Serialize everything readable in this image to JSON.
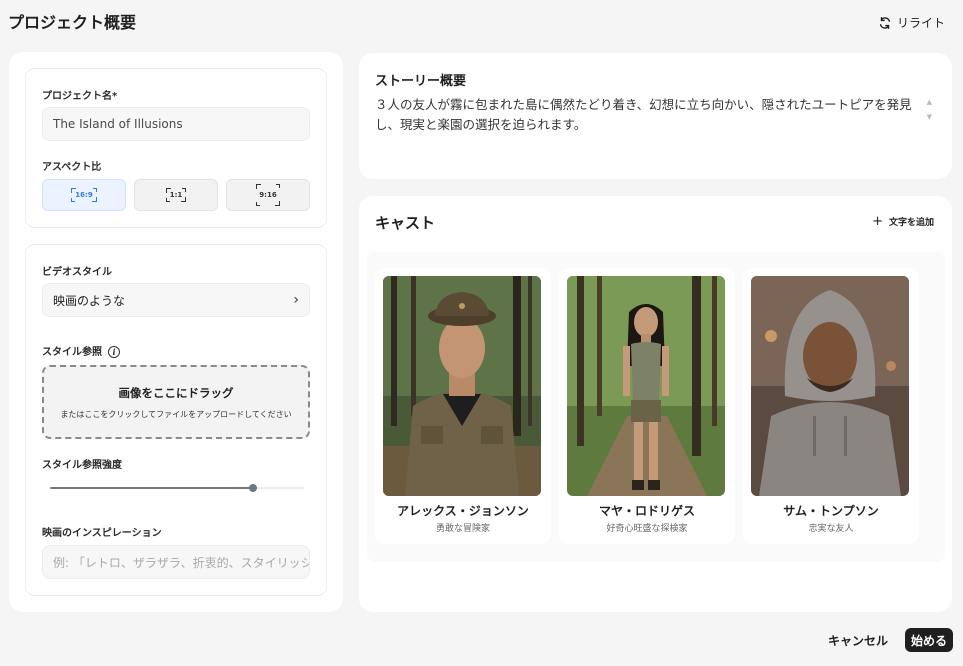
{
  "header": {
    "title": "プロジェクト概要",
    "rewrite_label": "リライト"
  },
  "project": {
    "name_label": "プロジェクト名*",
    "name_value": "The Island of Illusions",
    "aspect_label": "アスペクト比",
    "aspect_options": [
      "16:9",
      "1:1",
      "9:16"
    ],
    "aspect_selected": "16:9"
  },
  "video": {
    "style_label": "ビデオスタイル",
    "style_value": "映画のような",
    "ref_label": "スタイル参照",
    "dropzone_title": "画像をここにドラッグ",
    "dropzone_sub": "またはここをクリックしてファイルをアップロードしてください",
    "strength_label": "スタイル参照強度",
    "strength_value": 0.8,
    "inspiration_label": "映画のインスピレーション",
    "inspiration_placeholder": "例: 「レトロ、ザラザラ、折衷的、スタイリッシュ」"
  },
  "story": {
    "title": "ストーリー概要",
    "text": "３人の友人が霧に包まれた島に偶然たどり着き、幻想に立ち向かい、隠されたユートピアを発見し、現実と楽園の選択を迫られます。"
  },
  "cast": {
    "title": "キャスト",
    "add_label": "文字を追加",
    "members": [
      {
        "name": "アレックス・ジョンソン",
        "role": "勇敢な冒険家"
      },
      {
        "name": "マヤ・ロドリゲス",
        "role": "好奇心旺盛な探検家"
      },
      {
        "name": "サム・トンプソン",
        "role": "忠実な友人"
      }
    ]
  },
  "footer": {
    "cancel_label": "キャンセル",
    "start_label": "始める"
  }
}
